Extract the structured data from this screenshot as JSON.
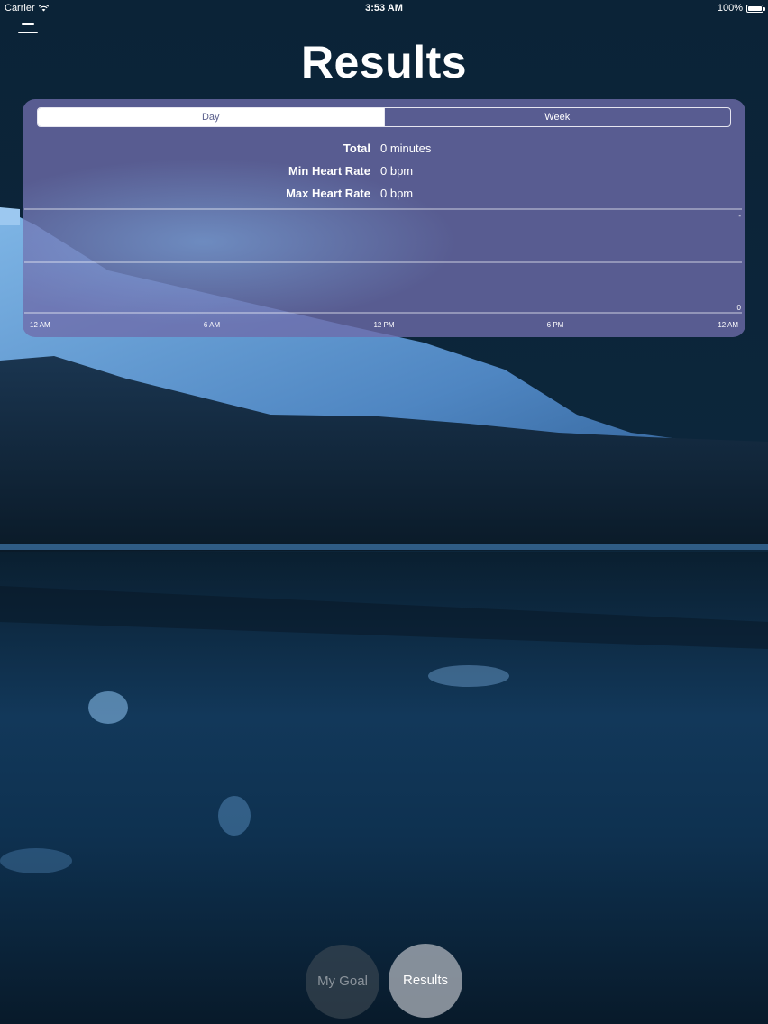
{
  "status_bar": {
    "carrier": "Carrier",
    "time": "3:53 AM",
    "battery": "100%",
    "battery_level": 1.0
  },
  "header": {
    "menu_icon": "hamburger-menu-icon",
    "title": "Results"
  },
  "card": {
    "tabs": [
      {
        "label": "Day",
        "selected": true
      },
      {
        "label": "Week",
        "selected": false
      }
    ],
    "stats": [
      {
        "label": "Total",
        "value": "0 minutes"
      },
      {
        "label": "Min Heart Rate",
        "value": "0 bpm"
      },
      {
        "label": "Max Heart Rate",
        "value": "0 bpm"
      }
    ]
  },
  "chart_data": {
    "type": "line",
    "x_tick_labels": [
      "12 AM",
      "6 AM",
      "12 PM",
      "6 PM",
      "12 AM"
    ],
    "y_tick_labels": [
      "-",
      "0"
    ],
    "series": [],
    "grid": true
  },
  "bottom_nav": {
    "goal_label": "My Goal",
    "results_label": "Results",
    "active": "Results"
  },
  "colors": {
    "card_background": "#6e6caa",
    "sky": "#0a2236",
    "lake": "#0c2b44"
  }
}
